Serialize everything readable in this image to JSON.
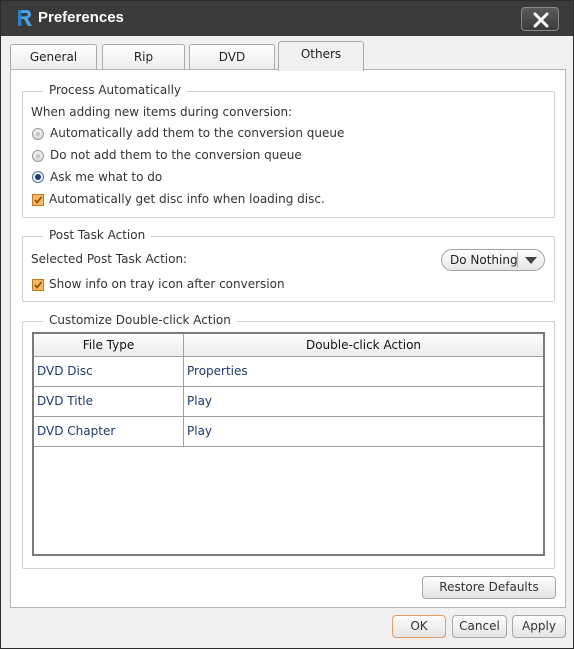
{
  "window": {
    "title": "Preferences",
    "close_icon": "close-icon",
    "logo_icon": "app-logo-icon"
  },
  "tabs": [
    {
      "label": "General",
      "active": false
    },
    {
      "label": "Rip",
      "active": false
    },
    {
      "label": "DVD",
      "active": false
    },
    {
      "label": "Others",
      "active": true
    }
  ],
  "process_group": {
    "title": "Process Automatically",
    "intro": "When adding new items during conversion:",
    "options": [
      {
        "label": "Automatically add them to the conversion queue",
        "checked": false,
        "enabled": false
      },
      {
        "label": "Do not add them to the conversion queue",
        "checked": false,
        "enabled": false
      },
      {
        "label": "Ask me what to do",
        "checked": true,
        "enabled": true
      }
    ],
    "checkbox_label": "Automatically get disc info when loading disc.",
    "checkbox_checked": true
  },
  "post_task_group": {
    "title": "Post Task Action",
    "selected_label": "Selected Post Task Action:",
    "dropdown_value": "Do Nothing",
    "checkbox_label": "Show info on tray icon after conversion",
    "checkbox_checked": true
  },
  "double_click_group": {
    "title": "Customize Double-click Action",
    "columns": [
      "File Type",
      "Double-click Action"
    ],
    "rows": [
      {
        "file_type": "DVD Disc",
        "action": "Properties"
      },
      {
        "file_type": "DVD Title",
        "action": "Play"
      },
      {
        "file_type": "DVD Chapter",
        "action": "Play"
      }
    ]
  },
  "buttons": {
    "restore_defaults": "Restore Defaults",
    "ok": "OK",
    "cancel": "Cancel",
    "apply": "Apply"
  },
  "colors": {
    "titlebar": "#3a3a3a",
    "checkbox_accent": "#e8911f",
    "link_text": "#1e3a6e",
    "ok_border": "#e59b64"
  }
}
